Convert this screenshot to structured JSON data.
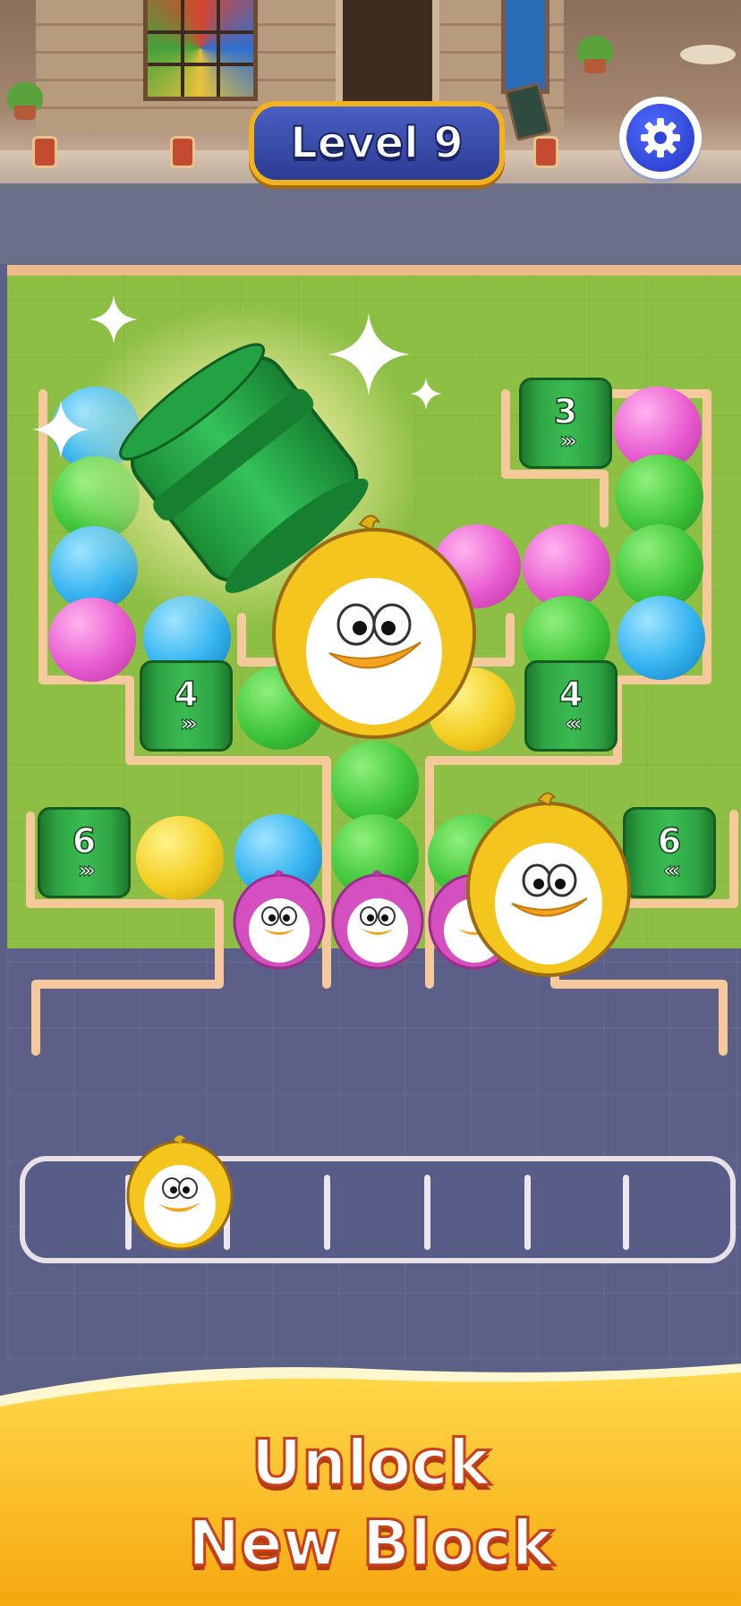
{
  "header": {
    "level_label": "Level 9",
    "settings_icon": "gear-icon"
  },
  "board": {
    "tunnels": [
      {
        "name": "tunnel-top-right",
        "count": "3",
        "arrows": "›››"
      },
      {
        "name": "tunnel-left-mid",
        "count": "4",
        "arrows": "›››"
      },
      {
        "name": "tunnel-right-mid",
        "count": "4",
        "arrows": "‹‹‹"
      },
      {
        "name": "tunnel-left-low",
        "count": "6",
        "arrows": "›››"
      },
      {
        "name": "tunnel-right-low",
        "count": "6",
        "arrows": "‹‹‹"
      }
    ],
    "colors": {
      "pink": "#e85bd0",
      "green": "#3fc53a",
      "blue": "#33b3ef",
      "yellow": "#f4cf22",
      "tunnel": "#2fa544"
    }
  },
  "tray": {
    "slots_total": 7,
    "slots_filled": 1,
    "filled_with": "yellow-penguin"
  },
  "banner": {
    "line1": "Unlock",
    "line2": "New Block"
  }
}
